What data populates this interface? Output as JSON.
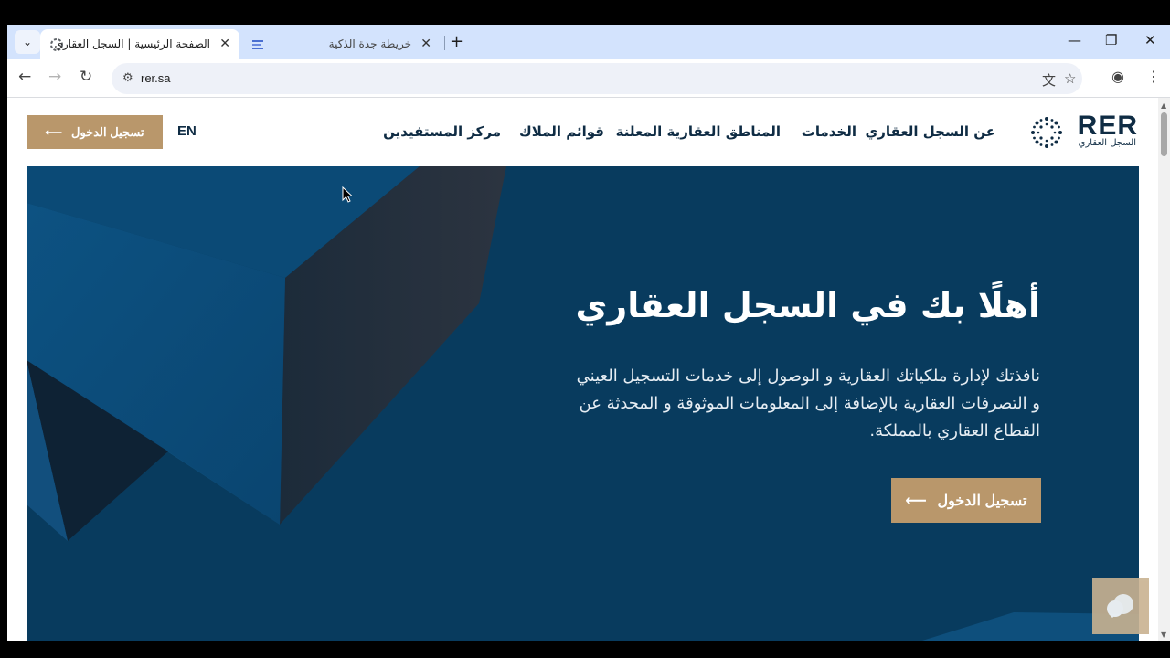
{
  "browser": {
    "tabs": [
      {
        "title": "الصفحة الرئيسية | السجل العقاري",
        "active": true
      },
      {
        "title": "خريطة جدة الذكية",
        "active": false
      }
    ],
    "new_tab": "+",
    "tab_menu": "⌄",
    "window_controls": {
      "minimize": "—",
      "restore": "❐",
      "close": "✕"
    },
    "url": "rer.sa",
    "icons": [
      "back-icon",
      "forward-icon",
      "reload-icon",
      "site-info-icon",
      "translate-icon",
      "bookmark-star-icon",
      "profile-icon",
      "menu-kebab-icon"
    ]
  },
  "site": {
    "logo_text": "RER",
    "logo_subtitle": "السجل العقاري",
    "nav": [
      {
        "label": "عن السجل العقاري"
      },
      {
        "label": "الخدمات"
      },
      {
        "label": "المناطق العقارية المعلنة"
      },
      {
        "label": "قوائم الملاك"
      },
      {
        "label": "مركز المستفيدين"
      }
    ],
    "language_toggle": "EN",
    "login_label": "تسجيل الدخول"
  },
  "hero": {
    "title": "أهلًا بك في السجل العقاري",
    "description": "نافذتك لإدارة ملكياتك العقارية و الوصول إلى خدمات التسجيل العيني و التصرفات العقارية بالإضافة إلى المعلومات الموثوقة و المحدثة عن القطاع العقاري بالمملكة.",
    "login_label": "تسجيل الدخول"
  },
  "colors": {
    "brand_navy": "#0f2c44",
    "hero_bg": "#083b5e",
    "accent_gold": "#b9976b"
  }
}
